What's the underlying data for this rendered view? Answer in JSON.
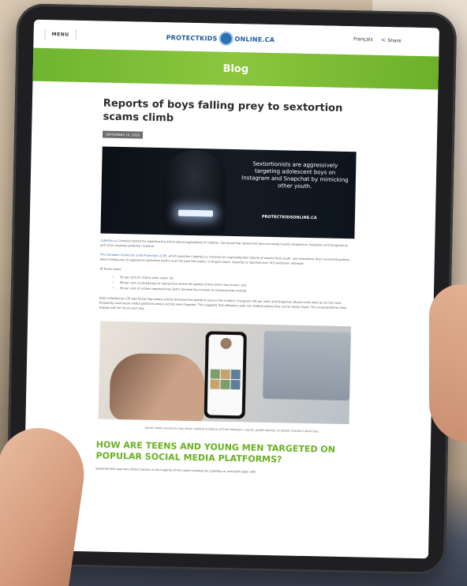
{
  "nav": {
    "menu_label": "MENU",
    "logo_left": "PROTECTKIDS",
    "logo_right": "ONLINE.CA",
    "lang_label": "Français",
    "share_label": "Share"
  },
  "banner": {
    "title": "Blog"
  },
  "article": {
    "headline": "Reports of boys falling prey to sextortion scams climb",
    "date": "SEPTEMBER 10, 2020",
    "hero_text": "Sextortionists are aggressively targeting adolescent boys on Instagram and Snapchat by mimicking other youth.",
    "hero_logo": "PROTECTKIDSONLINE.CA",
    "para1_link": "Cybertip.ca",
    "para1": ", Canada's tipline for reporting the online sexual exploitation of children, has found that adolescent boys are being heavily targeted on Instagram and Snapchat as part of an ongoing sextortion scheme.",
    "para2_link": "The Canadian Centre for Child Protection (C3P)",
    "para2": ", which operates Cybertip.ca, received an unprecedented volume of reports from youth, and sometimes their concerned parents, about falling prey to aggressive sextortion tactics over the past few weeks. In August alone, Cybertip.ca reported over 315 sextortion attempts.",
    "para3": "Of those cases:",
    "bullets": [
      "92 per cent of victims were under 18;",
      "86 per cent involved boys or young men where the gender of the victim was known; and",
      "59 per cent of victims reported they didn't disclose the incident to someone they trusted."
    ],
    "para4": "Data collected by C3P also found that where victims disclosed the platform used in the incident, Instagram (45 per cent) and Snapchat (36 per cent) were by far the most frequently used social media platforms where victims were targeted. This suggests that offenders seek out children where they can be easily found. The social platforms they engage with for hours each day.",
    "photo_caption": "Social media accounts may show credible evidence of their followers' counts, profile photos, or details shared in their bios.",
    "subhead": "How are teens and young men targeted on popular social media platforms?",
    "para5": "Sextortionists used two distinct tactics in the majority of the cases reviewed by Cybertip.ca, and both begin with"
  }
}
